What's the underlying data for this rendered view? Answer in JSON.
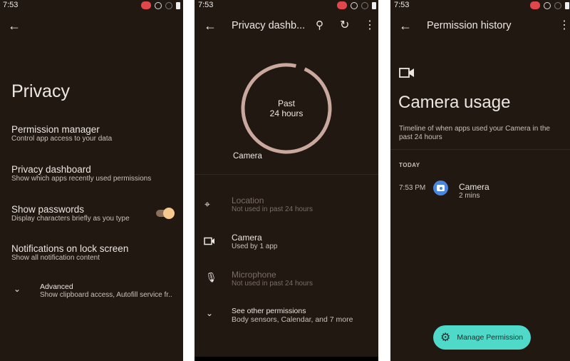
{
  "status": {
    "time": "7:53"
  },
  "privacy": {
    "title": "Privacy",
    "items": [
      {
        "title": "Permission manager",
        "subtitle": "Control app access to your data"
      },
      {
        "title": "Privacy dashboard",
        "subtitle": "Show which apps recently used permissions"
      },
      {
        "title": "Show passwords",
        "subtitle": "Display characters briefly as you type",
        "toggle_on": true
      },
      {
        "title": "Notifications on lock screen",
        "subtitle": "Show all notification content"
      }
    ],
    "advanced": {
      "title": "Advanced",
      "subtitle": "Show clipboard access, Autofill service fr.."
    }
  },
  "dashboard": {
    "title": "Privacy dashb...",
    "ring_label_1": "Past",
    "ring_label_2": "24 hours",
    "ring_legend": "Camera",
    "items": [
      {
        "title": "Location",
        "subtitle": "Not used in past 24 hours",
        "icon": "location-icon"
      },
      {
        "title": "Camera",
        "subtitle": "Used by 1 app",
        "icon": "videocam-icon"
      },
      {
        "title": "Microphone",
        "subtitle": "Not used in past 24 hours",
        "icon": "mic-icon"
      }
    ],
    "other": {
      "title": "See other permissions",
      "subtitle": "Body sensors, Calendar, and 7 more"
    },
    "colors": {
      "ring": "#c9a89e"
    }
  },
  "history": {
    "title": "Permission history",
    "heading": "Camera usage",
    "description": "Timeline of when apps used your Camera in the past 24 hours",
    "section": "TODAY",
    "entry": {
      "time": "7:53 PM",
      "app": "Camera",
      "duration": "2 mins"
    },
    "fab_label": "Manage Permission",
    "colors": {
      "fab": "#4fd9c9",
      "app_icon": "#4a86e0"
    }
  }
}
